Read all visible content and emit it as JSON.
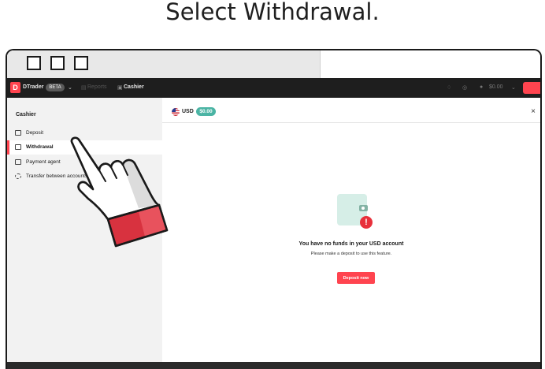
{
  "heading": "Select Withdrawal.",
  "appbar": {
    "app_name": "DTrader",
    "beta_badge": "BETA",
    "reports": "Reports",
    "cashier": "Cashier",
    "balance": "$0.00"
  },
  "sidebar": {
    "title": "Cashier",
    "items": [
      {
        "label": "Deposit",
        "active": false
      },
      {
        "label": "Withdrawal",
        "active": true
      },
      {
        "label": "Payment agent",
        "active": false
      },
      {
        "label": "Transfer between accounts",
        "active": false
      }
    ]
  },
  "main": {
    "currency": "USD",
    "balance_badge": "$0.00",
    "close_symbol": "×",
    "empty_title": "You have no funds in your USD account",
    "empty_subtitle": "Please make a deposit to use this feature.",
    "deposit_button": "Deposit now",
    "alert_symbol": "!"
  },
  "colors": {
    "accent": "#ff444f",
    "teal_badge": "#4bb4a4",
    "sidebar_bg": "#f2f2f2",
    "appbar_bg": "#1e1e1e"
  },
  "icons": [
    "pointing-hand-icon",
    "wallet-icon",
    "alert-icon",
    "us-flag-icon",
    "close-icon"
  ]
}
